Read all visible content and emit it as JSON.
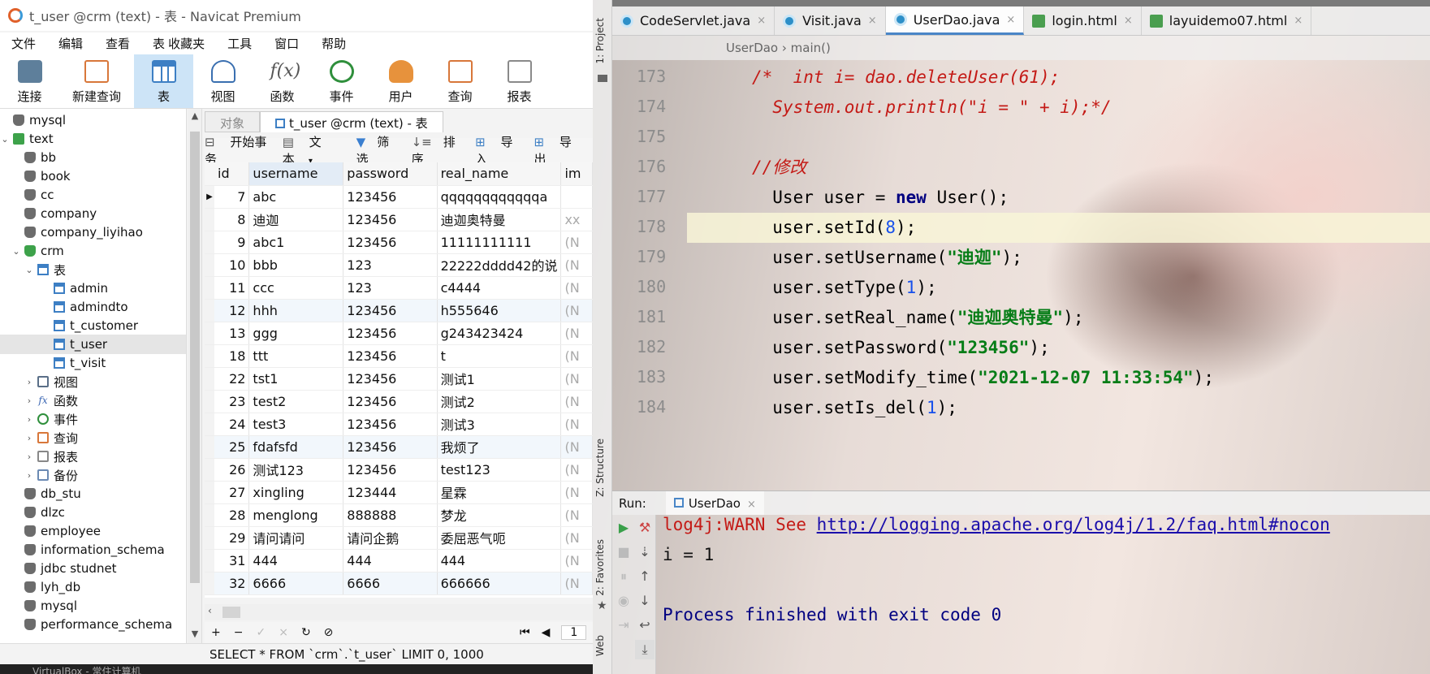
{
  "navicat": {
    "window_title": "t_user @crm (text) - 表 - Navicat Premium",
    "menu": [
      "文件",
      "编辑",
      "查看",
      "表",
      "收藏夹",
      "工具",
      "窗口",
      "帮助"
    ],
    "toolbar": [
      "连接",
      "新建查询",
      "表",
      "视图",
      "函数",
      "事件",
      "用户",
      "查询",
      "报表"
    ],
    "sidebar": {
      "items": [
        {
          "label": "mysql"
        },
        {
          "label": "text"
        },
        {
          "label": "bb"
        },
        {
          "label": "book"
        },
        {
          "label": "cc"
        },
        {
          "label": "company"
        },
        {
          "label": "company_liyihao"
        },
        {
          "label": "crm"
        },
        {
          "label": "表"
        },
        {
          "label": "admin"
        },
        {
          "label": "admindto"
        },
        {
          "label": "t_customer"
        },
        {
          "label": "t_user"
        },
        {
          "label": "t_visit"
        },
        {
          "label": "视图"
        },
        {
          "label": "函数"
        },
        {
          "label": "事件"
        },
        {
          "label": "查询"
        },
        {
          "label": "报表"
        },
        {
          "label": "备份"
        },
        {
          "label": "db_stu"
        },
        {
          "label": "dlzc"
        },
        {
          "label": "employee"
        },
        {
          "label": "information_schema"
        },
        {
          "label": "jdbc studnet"
        },
        {
          "label": "lyh_db"
        },
        {
          "label": "mysql"
        },
        {
          "label": "performance_schema"
        }
      ]
    },
    "tabs": {
      "objects": "对象",
      "active": "t_user @crm (text) - 表"
    },
    "subtoolbar": {
      "begin_tx": "开始事务",
      "text": "文本",
      "filter": "筛选",
      "sort": "排序",
      "import": "导入",
      "export": "导出"
    },
    "grid": {
      "columns": [
        "id",
        "username",
        "password",
        "real_name",
        "im"
      ],
      "rows": [
        [
          "7",
          "abc",
          "123456",
          "qqqqqqqqqqqqa",
          ""
        ],
        [
          "8",
          "迪迦",
          "123456",
          "迪迦奥特曼",
          "xx"
        ],
        [
          "9",
          "abc1",
          "123456",
          "11111111111",
          "(N"
        ],
        [
          "10",
          "bbb",
          "123",
          "22222dddd42的说",
          "(N"
        ],
        [
          "11",
          "ccc",
          "123",
          "c4444",
          "(N"
        ],
        [
          "12",
          "hhh",
          "123456",
          "h555646",
          "(N"
        ],
        [
          "13",
          "ggg",
          "123456",
          "g243423424",
          "(N"
        ],
        [
          "18",
          "ttt",
          "123456",
          "t",
          "(N"
        ],
        [
          "22",
          "tst1",
          "123456",
          "测试1",
          "(N"
        ],
        [
          "23",
          "test2",
          "123456",
          "测试2",
          "(N"
        ],
        [
          "24",
          "test3",
          "123456",
          "测试3",
          "(N"
        ],
        [
          "25",
          "fdafsfd",
          "123456",
          "我烦了",
          "(N"
        ],
        [
          "26",
          "测试123",
          "123456",
          "test123",
          "(N"
        ],
        [
          "27",
          "xingling",
          "123444",
          "星霖",
          "(N"
        ],
        [
          "28",
          "menglong",
          "888888",
          "梦龙",
          "(N"
        ],
        [
          "29",
          "请问请问",
          "请问企鹅",
          "委屈恶气呃",
          "(N"
        ],
        [
          "31",
          "444",
          "444",
          "444",
          "(N"
        ],
        [
          "32",
          "6666",
          "6666",
          "666666",
          "(N"
        ]
      ]
    },
    "page_number": "1",
    "sql": "SELECT * FROM `crm`.`t_user` LIMIT 0, 1000",
    "taskbar_text": "VirtualBox - 常住计算机"
  },
  "idea": {
    "tool_strip": {
      "project": "1: Project",
      "structure": "Z: Structure",
      "favorites": "2: Favorites",
      "web": "Web"
    },
    "tabs": [
      {
        "label": "CodeServlet.java",
        "icon": "java-class-icon"
      },
      {
        "label": "Visit.java",
        "icon": "java-class-icon"
      },
      {
        "label": "UserDao.java",
        "icon": "java-class-icon"
      },
      {
        "label": "login.html",
        "icon": "html-file-icon"
      },
      {
        "label": "layuidemo07.html",
        "icon": "html-file-icon"
      }
    ],
    "breadcrumb": {
      "class": "UserDao",
      "method": "main()"
    },
    "line_numbers": [
      "173",
      "174",
      "175",
      "176",
      "177",
      "178",
      "179",
      "180",
      "181",
      "182",
      "183",
      "184"
    ],
    "code": {
      "l173": "/*  int i= dao.deleteUser(61);",
      "l174": "  System.out.println(\"i = \" + i);*/",
      "l176": "//修改",
      "l177a": "  User user = ",
      "l177b": "new",
      "l177c": " User();",
      "l178a": "  user.setId(",
      "l178b": "8",
      "l178c": ");",
      "l179a": "  user.setUsername(",
      "l179b": "\"迪迦\"",
      "l179c": ");",
      "l180a": "  user.setType(",
      "l180b": "1",
      "l180c": ");",
      "l181a": "  user.setReal_name(",
      "l181b": "\"迪迦奥特曼\"",
      "l181c": ");",
      "l182a": "  user.setPassword(",
      "l182b": "\"123456\"",
      "l182c": ");",
      "l183a": "  user.setModify_time(",
      "l183b": "\"2021-12-07 11:33:54\"",
      "l183c": ");",
      "l184a": "  user.setIs_del(",
      "l184b": "1",
      "l184c": ");"
    },
    "run": {
      "label": "Run:",
      "tab": "UserDao",
      "warn_prefix": "log4j:WARN See ",
      "warn_link": "http://logging.apache.org/log4j/1.2/faq.html#nocon",
      "output": "i = 1",
      "exit": "Process finished with exit code 0"
    }
  },
  "colors": {
    "accent": "#4a86c7",
    "comment": "#c41a16",
    "keyword": "#000080",
    "string": "#067d17",
    "number": "#1750eb"
  }
}
